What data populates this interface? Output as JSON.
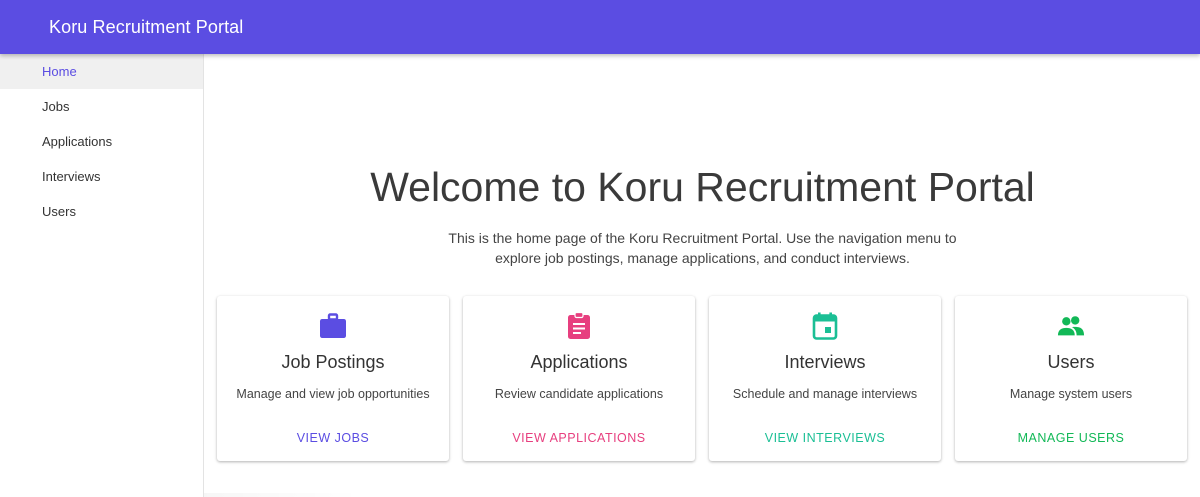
{
  "header": {
    "title": "Koru Recruitment Portal"
  },
  "sidebar": {
    "items": [
      {
        "label": "Home",
        "active": true
      },
      {
        "label": "Jobs",
        "active": false
      },
      {
        "label": "Applications",
        "active": false
      },
      {
        "label": "Interviews",
        "active": false
      },
      {
        "label": "Users",
        "active": false
      }
    ]
  },
  "main": {
    "title": "Welcome to Koru Recruitment Portal",
    "intro_line1": "This is the home page of the Koru Recruitment Portal. Use the navigation menu to",
    "intro_line2": "explore job postings, manage applications, and conduct interviews."
  },
  "cards": [
    {
      "icon": "briefcase-icon",
      "color": "#5b4de2",
      "title": "Job Postings",
      "description": "Manage and view job opportunities",
      "action": "VIEW JOBS"
    },
    {
      "icon": "clipboard-icon",
      "color": "#e73f7f",
      "title": "Applications",
      "description": "Review candidate applications",
      "action": "VIEW APPLICATIONS"
    },
    {
      "icon": "calendar-icon",
      "color": "#1bbf95",
      "title": "Interviews",
      "description": "Schedule and manage interviews",
      "action": "VIEW INTERVIEWS"
    },
    {
      "icon": "people-icon",
      "color": "#12b857",
      "title": "Users",
      "description": "Manage system users",
      "action": "MANAGE USERS"
    }
  ],
  "colors": {
    "primary": "#5b4de2",
    "active_bg": "#f0f0f0"
  }
}
